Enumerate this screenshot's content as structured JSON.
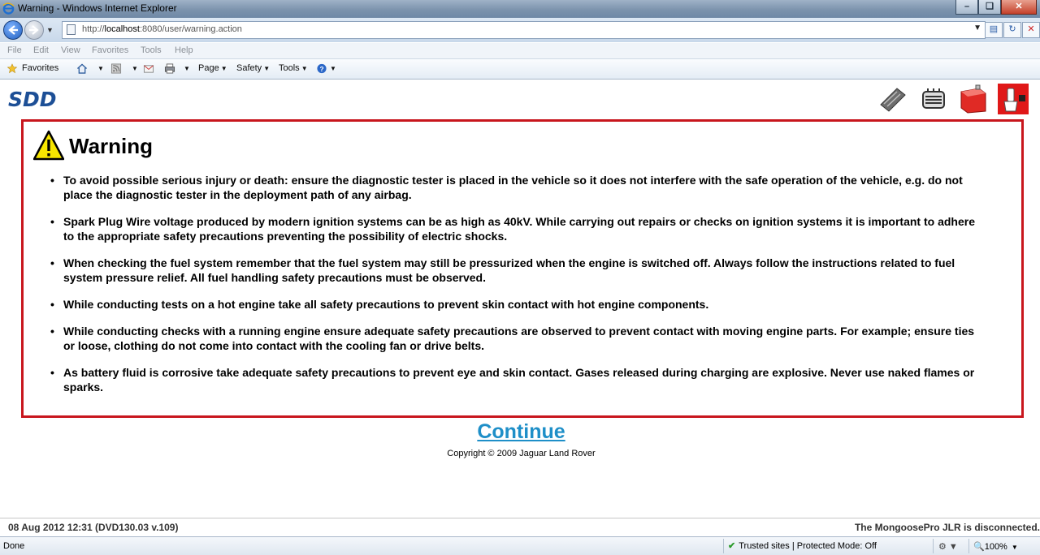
{
  "window": {
    "title": "Warning - Windows Internet Explorer"
  },
  "address_bar": {
    "url_prefix": "http://",
    "url_host": "localhost",
    "url_rest": ":8080/user/warning.action"
  },
  "menu": {
    "items": [
      "File",
      "Edit",
      "View",
      "Favorites",
      "Tools",
      "Help"
    ]
  },
  "command_bar": {
    "favorites": "Favorites",
    "page": "Page",
    "safety": "Safety",
    "tools": "Tools"
  },
  "app": {
    "logo": "SDD"
  },
  "warning": {
    "title": "Warning",
    "items": [
      "To avoid possible serious injury or death: ensure the diagnostic tester is placed in the vehicle so it does not interfere with the safe operation of the vehicle, e.g. do not place the diagnostic tester in the deployment path of any airbag.",
      "Spark Plug Wire voltage produced by modern ignition systems can be as high as 40kV. While carrying out repairs or checks on ignition systems it is important to adhere to the appropriate safety precautions preventing the possibility of electric shocks.",
      "When checking the fuel system remember that the fuel system may still be pressurized when the engine is switched off. Always follow the instructions related to fuel system pressure relief. All fuel handling safety precautions must be observed.",
      "While conducting tests on a hot engine take all safety precautions to prevent skin contact with hot engine components.",
      "While conducting checks with a running engine ensure adequate safety precautions are observed to prevent contact with moving engine parts. For example; ensure ties or loose, clothing do not come into contact with the cooling fan or drive belts.",
      "As battery fluid is corrosive take adequate safety precautions to prevent eye and skin contact. Gases released during charging are explosive. Never use naked flames or sparks."
    ]
  },
  "continue_label": "Continue",
  "copyright": "Copyright © 2009 Jaguar Land Rover",
  "page_footer": {
    "left": "08 Aug 2012 12:31 (DVD130.03 v.109)",
    "right": "The MongoosePro JLR is disconnected."
  },
  "status_bar": {
    "status": "Done",
    "zone": "Trusted sites | Protected Mode: Off",
    "zoom": "100%"
  },
  "colors": {
    "warning_border": "#c8161d",
    "continue_link": "#1e8fc8",
    "logo": "#1d4f96"
  }
}
